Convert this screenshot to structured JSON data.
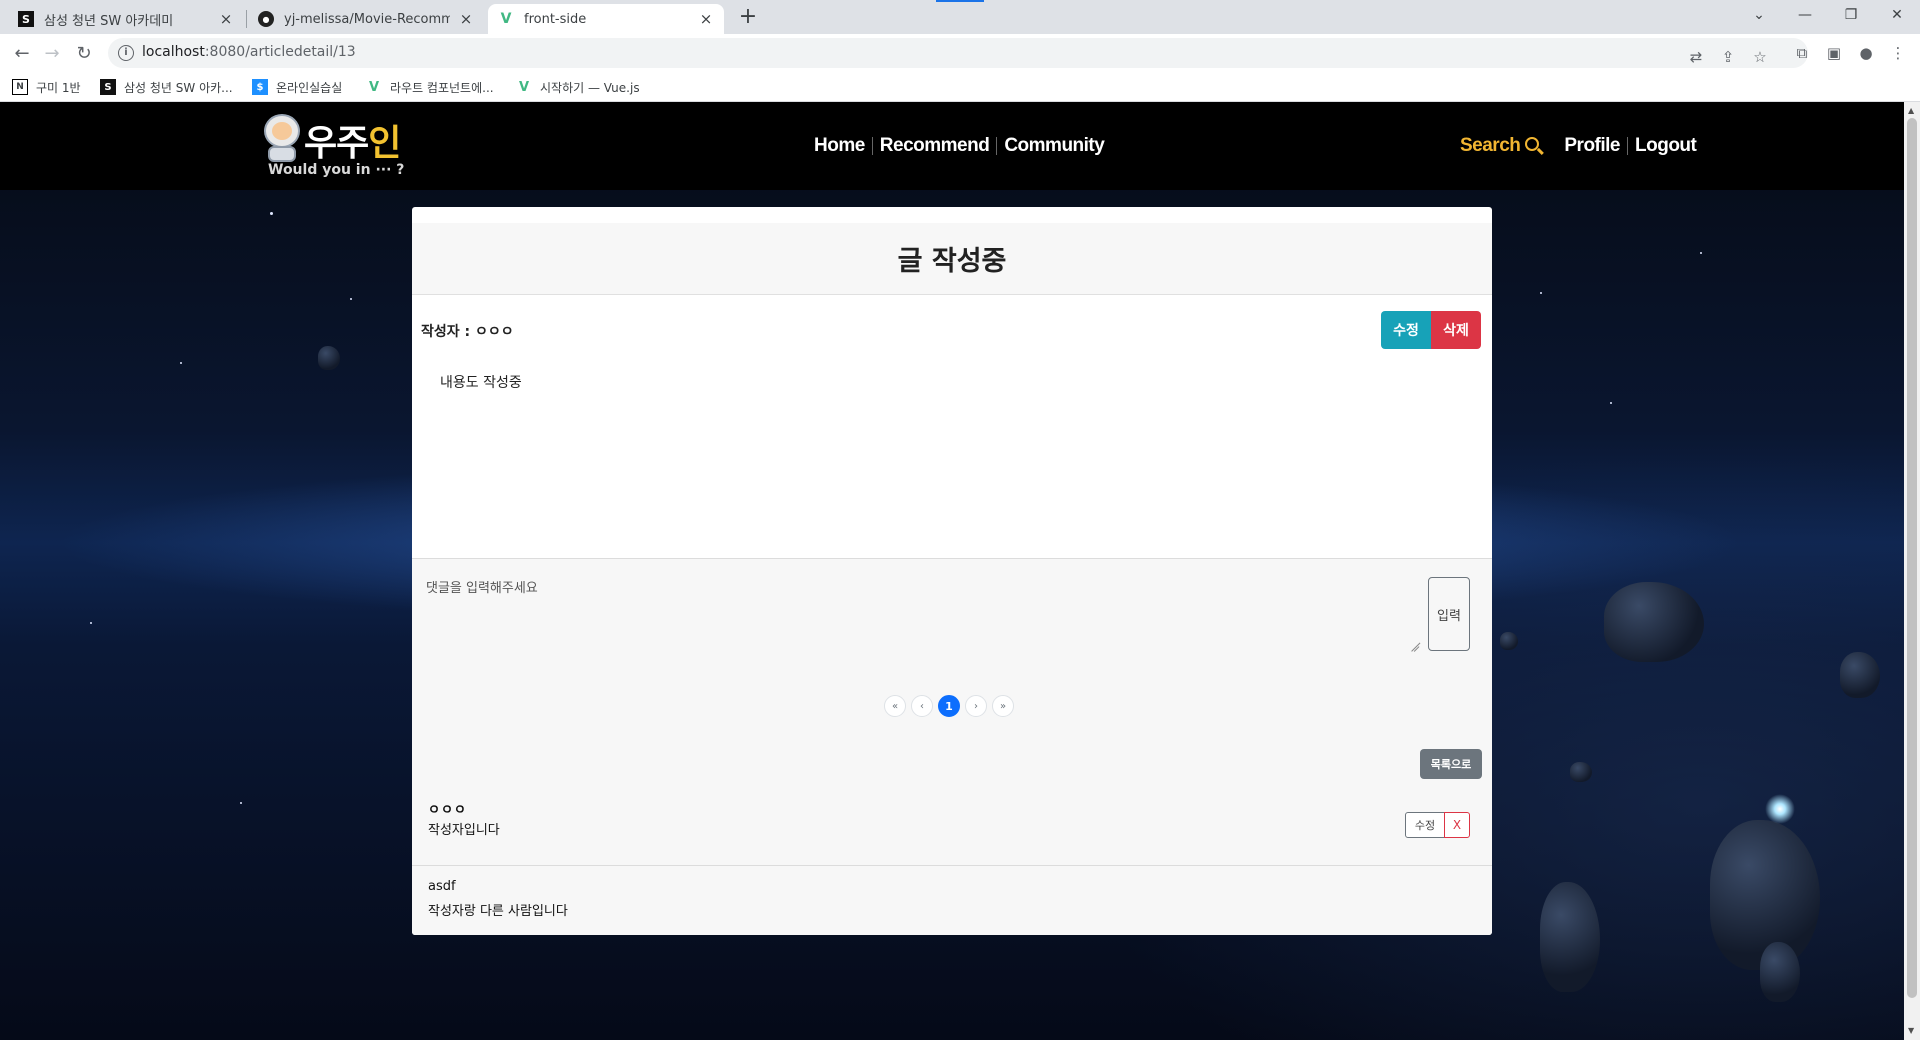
{
  "browser": {
    "tabs": [
      {
        "title": "삼성 청년 SW 아카데미",
        "favicon": "S"
      },
      {
        "title": "yj-melissa/Movie-Recommend-",
        "favicon": "gh"
      },
      {
        "title": "front-side",
        "favicon": "V"
      }
    ],
    "active_tab_index": 2,
    "url_host": "localhost",
    "url_path": ":8080/articledetail/13",
    "bookmarks": [
      {
        "label": "구미 1반",
        "icon": "notion-icon"
      },
      {
        "label": "삼성 청년 SW 아카...",
        "icon": "ssafy-icon"
      },
      {
        "label": "온라인실습실",
        "icon": "lab-icon"
      },
      {
        "label": "라우트 컴포넌트에...",
        "icon": "vue-icon"
      },
      {
        "label": "시작하기 — Vue.js",
        "icon": "vue-icon"
      }
    ]
  },
  "site": {
    "logo": {
      "word1": "우주",
      "word2": "인",
      "tagline": "Would you in ··· ?"
    },
    "nav": {
      "home": "Home",
      "recommend": "Recommend",
      "community": "Community"
    },
    "right_nav": {
      "search": "Search",
      "profile": "Profile",
      "logout": "Logout"
    }
  },
  "article": {
    "title": "글 작성중",
    "author_line": "작성자 : ㅇㅇㅇ",
    "edit_label": "수정",
    "delete_label": "삭제",
    "content": "내용도 작성중"
  },
  "comments": {
    "input_placeholder": "댓글을 입력해주세요",
    "submit_label": "입력",
    "pagination": {
      "first": "«",
      "prev": "‹",
      "current": "1",
      "next": "›",
      "last": "»"
    },
    "back_to_list_label": "목록으로",
    "items": [
      {
        "author": "ㅇㅇㅇ",
        "text": "작성자입니다",
        "edit_label": "수정",
        "delete_label": "X"
      },
      {
        "author": "asdf",
        "text": "작성자랑 다른 사람입니다"
      }
    ]
  },
  "colors": {
    "accent_search": "#f2b632",
    "edit_button": "#17a2b8",
    "delete_button": "#dc3545",
    "page_active": "#0d6efd",
    "list_button": "#6c757d"
  }
}
